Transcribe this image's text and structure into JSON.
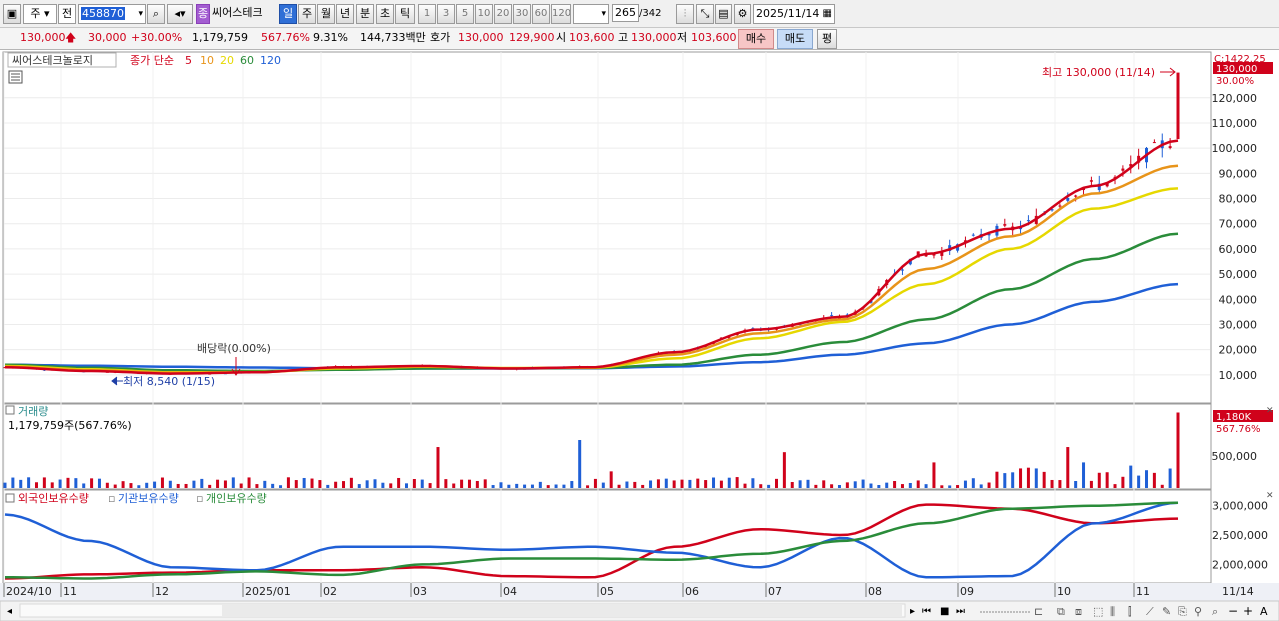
{
  "toolbar": {
    "period_type": "주",
    "compare": "전",
    "code": "458870",
    "stock_name": "씨어스테크",
    "periods": [
      "일",
      "주",
      "월",
      "년",
      "분",
      "초",
      "틱"
    ],
    "intervals": [
      "1",
      "3",
      "5",
      "10",
      "20",
      "30",
      "60",
      "120"
    ],
    "count": "265",
    "count_total": "/342",
    "date": "2025/11/14"
  },
  "quote": {
    "price": "130,000",
    "change": "30,000",
    "change_pct": "+30.00%",
    "volume": "1,179,759",
    "volume_pct": "567.76%",
    "turnover": "9.31%",
    "amount": "144,733백만",
    "hoga_label": "호가",
    "ask": "130,000",
    "bid": "129,900",
    "open_label": "시",
    "open": "103,600",
    "high_label": "고",
    "high": "130,000",
    "low_label": "저",
    "low": "103,600",
    "buy_label": "매수",
    "sell_label": "매도",
    "extra_label": "평"
  },
  "price_panel": {
    "legend_name": "씨어스테크놀로지",
    "legend_ma_label": "종가 단순",
    "ma": [
      {
        "label": "5",
        "color": "#d0021b"
      },
      {
        "label": "10",
        "color": "#e8941a"
      },
      {
        "label": "20",
        "color": "#e6d800"
      },
      {
        "label": "60",
        "color": "#2a8c3a"
      },
      {
        "label": "120",
        "color": "#1f5fd6"
      }
    ],
    "top_right_label": "C:1422.25",
    "current_badge": "130,000",
    "current_pct": "30.00%",
    "high_annotation": "최고 130,000 (11/14)",
    "low_annotation": "최저 8,540 (1/15)",
    "dividend_annotation": "배당락(0.00%)"
  },
  "volume_panel": {
    "title": "거래량",
    "value_text": "1,179,759주(567.76%)",
    "badge": "1,180K",
    "badge_pct": "567.76%"
  },
  "holding_panel": {
    "legend": [
      {
        "label": "외국인보유수량",
        "color": "#d0021b"
      },
      {
        "label": "기관보유수량",
        "color": "#1f5fd6"
      },
      {
        "label": "개인보유수량",
        "color": "#2a8c3a"
      }
    ]
  },
  "x_axis": {
    "labels": [
      "2024/10",
      "11",
      "12",
      "2025/01",
      "02",
      "03",
      "04",
      "05",
      "06",
      "07",
      "08",
      "09",
      "10",
      "11"
    ],
    "right_label": "11/14"
  },
  "chart_data": [
    {
      "type": "line",
      "title": "",
      "ylabel": "",
      "y_ticks": [
        "10,000",
        "20,000",
        "30,000",
        "40,000",
        "50,000",
        "60,000",
        "70,000",
        "80,000",
        "90,000",
        "100,000",
        "110,000",
        "120,000"
      ],
      "ylim": [
        0,
        135000
      ],
      "x": [
        "2024/10",
        "11",
        "12",
        "2025/01",
        "02",
        "03",
        "04",
        "05",
        "06",
        "07",
        "08",
        "09",
        "10",
        "11",
        "11/14"
      ],
      "series": [
        {
          "name": "5",
          "values": [
            13000,
            11500,
            10500,
            11000,
            13000,
            13500,
            12500,
            13000,
            19000,
            28000,
            33000,
            58000,
            68000,
            85000,
            103000
          ]
        },
        {
          "name": "10",
          "values": [
            13200,
            11800,
            10800,
            11000,
            12800,
            13400,
            12600,
            12900,
            18000,
            26500,
            32000,
            52000,
            65000,
            82000,
            93000
          ]
        },
        {
          "name": "20",
          "values": [
            13500,
            12200,
            11000,
            11100,
            12500,
            13200,
            12700,
            12800,
            16500,
            24500,
            31000,
            46000,
            60000,
            76000,
            84000
          ]
        },
        {
          "name": "60",
          "values": [
            14000,
            12800,
            11800,
            11500,
            12000,
            12500,
            12600,
            12700,
            14000,
            18000,
            23000,
            32000,
            44000,
            56000,
            66000
          ]
        },
        {
          "name": "120",
          "values": [
            14000,
            13600,
            13200,
            12900,
            12600,
            12500,
            12500,
            12600,
            13300,
            15000,
            18000,
            22500,
            30000,
            39000,
            46000
          ]
        }
      ],
      "high": 130000,
      "low": 8540
    },
    {
      "type": "bar",
      "title": "거래량",
      "y_ticks": [
        "500,000"
      ],
      "ylim": [
        0,
        1250000
      ],
      "last_value": 1179759
    },
    {
      "type": "line",
      "title": "",
      "y_ticks": [
        "2,000,000",
        "2,500,000",
        "3,000,000"
      ],
      "ylim": [
        1700000,
        3200000
      ],
      "series": [
        {
          "name": "외국인보유수량",
          "values": [
            1760000,
            1830000,
            1860000,
            1900000,
            1900000,
            1950000,
            1800000,
            1780000,
            2300000,
            2600000,
            2500000,
            3020000,
            2950000,
            2700000,
            2780000
          ]
        },
        {
          "name": "기관보유수량",
          "values": [
            2850000,
            2400000,
            1950000,
            1900000,
            2300000,
            2300000,
            2250000,
            2300000,
            2200000,
            1950000,
            2450000,
            1780000,
            1800000,
            2700000,
            3050000
          ]
        },
        {
          "name": "개인보유수량",
          "values": [
            1780000,
            1760000,
            1830000,
            1880000,
            1820000,
            2000000,
            2100000,
            2100000,
            2080000,
            2180000,
            2400000,
            2700000,
            2950000,
            3000000,
            3050000
          ]
        }
      ]
    }
  ]
}
